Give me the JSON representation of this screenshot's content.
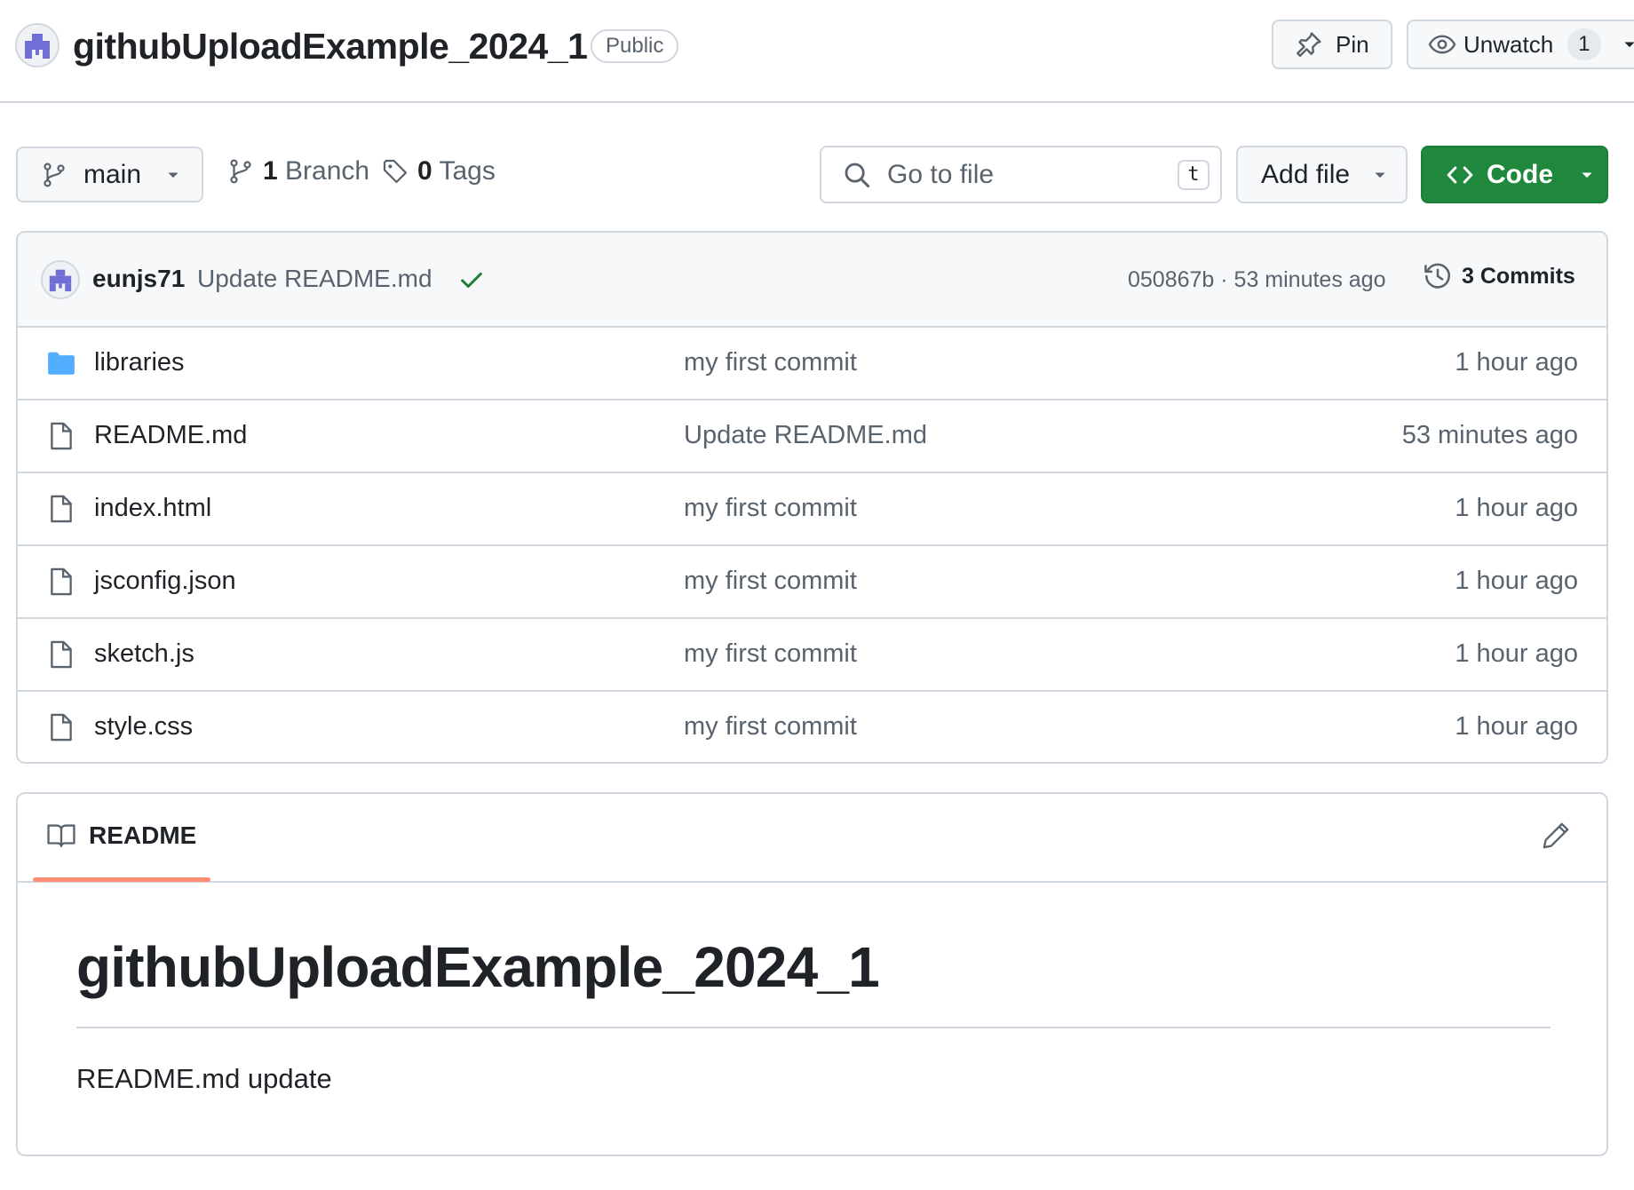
{
  "repo": {
    "name": "githubUploadExample_2024_1",
    "visibility": "Public",
    "pin_label": "Pin",
    "watch_label": "Unwatch",
    "watch_count": "1"
  },
  "toolbar": {
    "branch": "main",
    "branch_count": "1",
    "branch_label": "Branch",
    "tag_count": "0",
    "tag_label": "Tags",
    "search_placeholder": "Go to file",
    "search_shortcut": "t",
    "add_file_label": "Add file",
    "code_label": "Code"
  },
  "last_commit": {
    "author": "eunjs71",
    "message": "Update README.md",
    "sha_time": "050867b · 53 minutes ago",
    "commits_label": "3 Commits"
  },
  "files": [
    {
      "name": "libraries",
      "type": "folder",
      "message": "my first commit",
      "time": "1 hour ago"
    },
    {
      "name": "README.md",
      "type": "file",
      "message": "Update README.md",
      "time": "53 minutes ago"
    },
    {
      "name": "index.html",
      "type": "file",
      "message": "my first commit",
      "time": "1 hour ago"
    },
    {
      "name": "jsconfig.json",
      "type": "file",
      "message": "my first commit",
      "time": "1 hour ago"
    },
    {
      "name": "sketch.js",
      "type": "file",
      "message": "my first commit",
      "time": "1 hour ago"
    },
    {
      "name": "style.css",
      "type": "file",
      "message": "my first commit",
      "time": "1 hour ago"
    }
  ],
  "readme": {
    "tab_label": "README",
    "heading": "githubUploadExample_2024_1",
    "body": "README.md update"
  },
  "colors": {
    "accent_green": "#1f883d",
    "folder_blue": "#54aeff",
    "tab_underline": "#fd8c73"
  }
}
